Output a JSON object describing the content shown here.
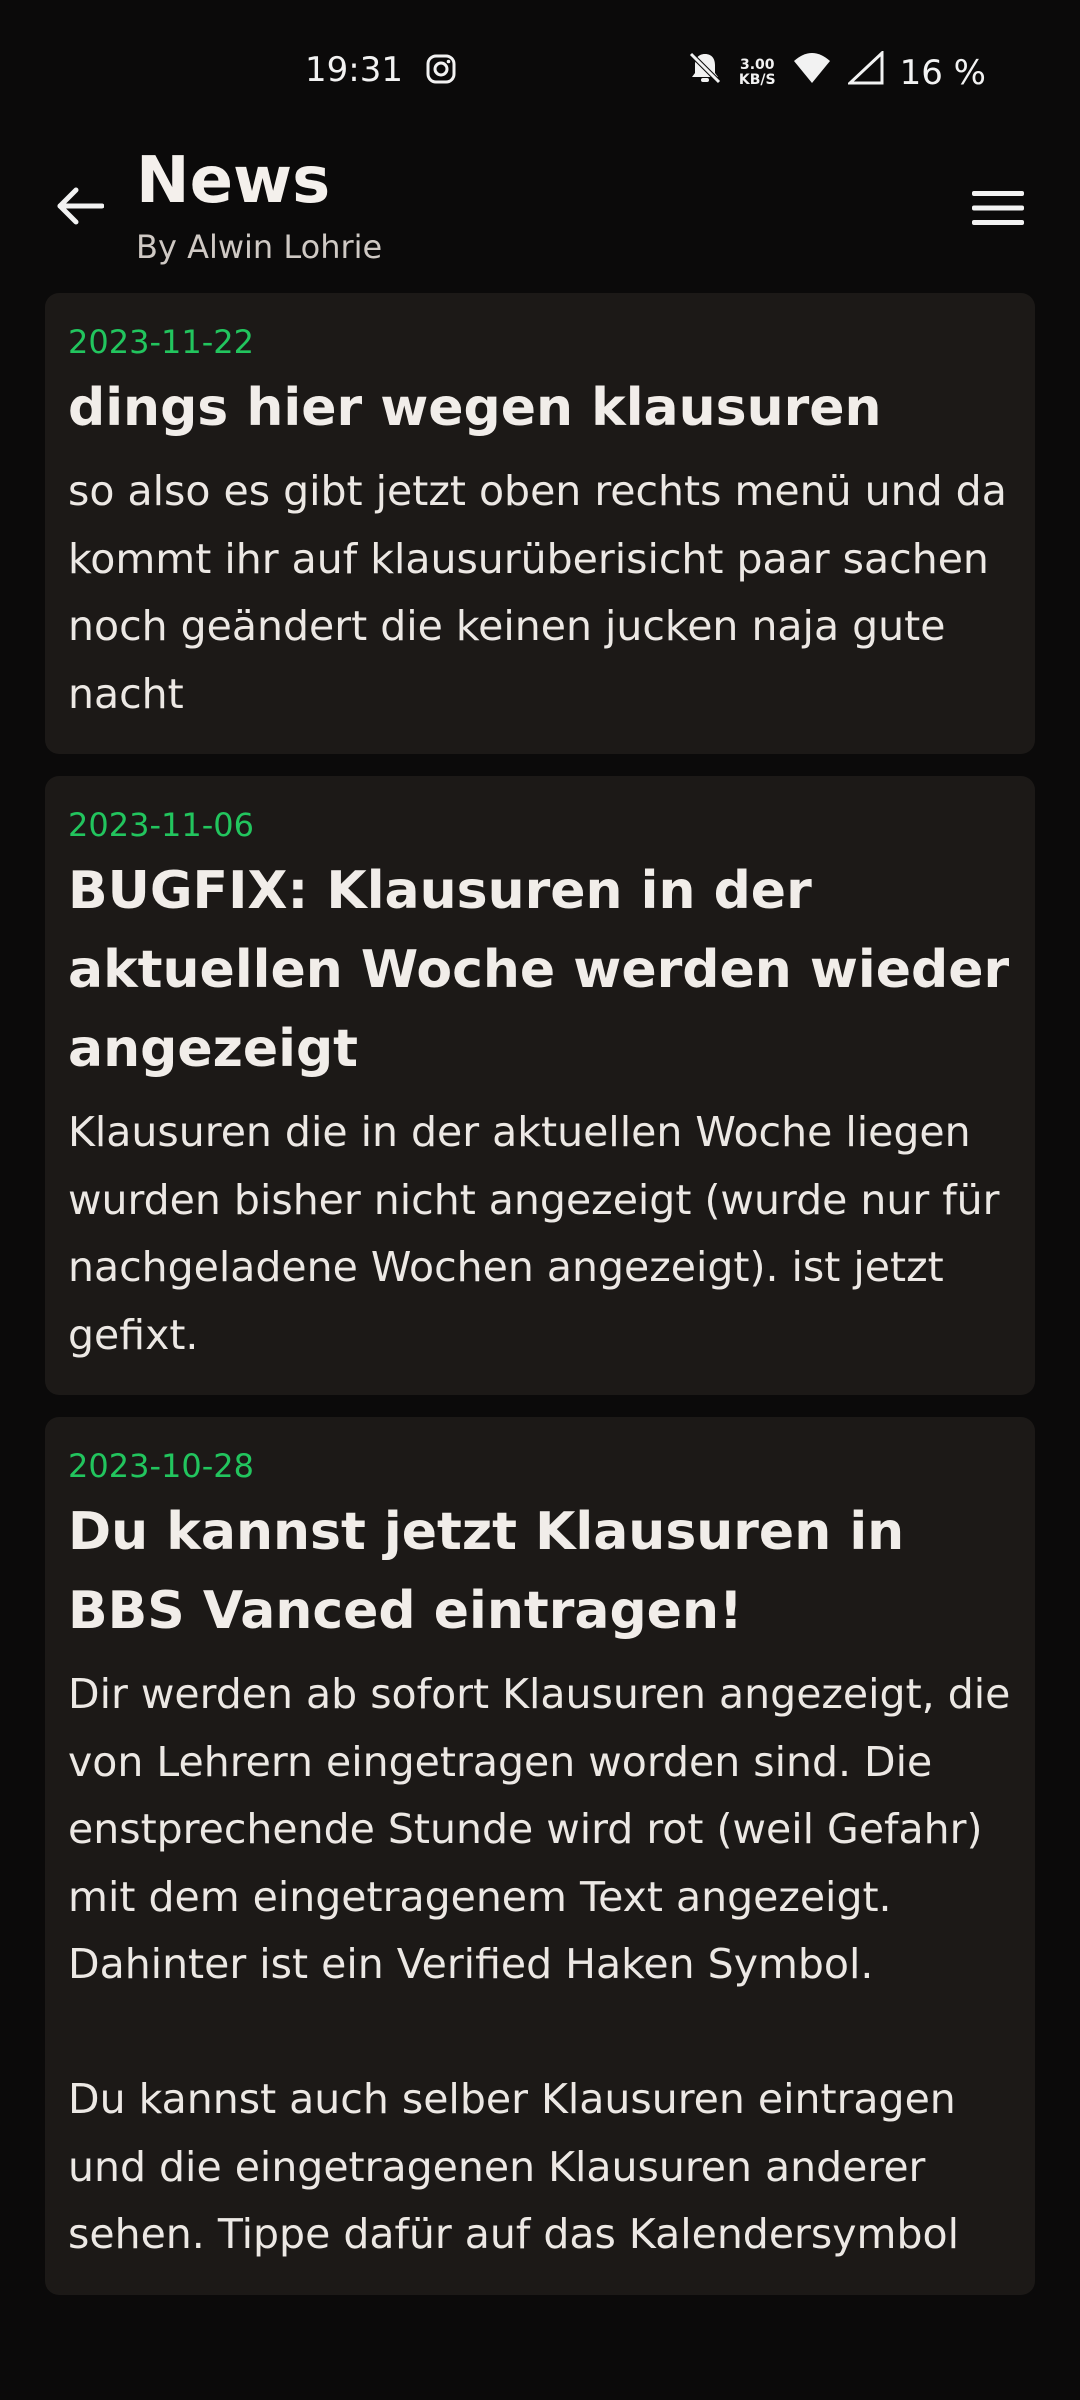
{
  "status_bar": {
    "time": "19:31",
    "speed_value": "3.00",
    "speed_unit": "KB/S",
    "battery": "16 %",
    "icons": [
      "instagram-icon",
      "bell-off-icon",
      "wifi-icon",
      "signal-icon"
    ]
  },
  "app_bar": {
    "title": "News",
    "subtitle": "By Alwin Lohrie",
    "back_icon": "arrow-left-icon",
    "menu_icon": "hamburger-menu-icon"
  },
  "colors": {
    "background": "#0b0a0a",
    "card": "#1c1917",
    "accent_date": "#22c55e",
    "text": "#ece8e4"
  },
  "news": [
    {
      "date": "2023-11-22",
      "title": "dings hier wegen klausuren",
      "body": "so also es gibt jetzt oben rechts menü und da kommt ihr auf klausurüberisicht paar sachen noch geändert die keinen jucken naja gute nacht"
    },
    {
      "date": "2023-11-06",
      "title": "BUGFIX: Klausuren in der aktuellen Woche werden wieder angezeigt",
      "body": "Klausuren die in der aktuellen Woche liegen wurden bisher nicht angezeigt (wurde nur für nachgeladene Wochen angezeigt). ist jetzt gefixt."
    },
    {
      "date": "2023-10-28",
      "title": "Du kannst jetzt Klausuren in BBS Vanced eintragen!",
      "body": "Dir werden ab sofort Klausuren angezeigt, die von Lehrern eingetragen worden sind. Die enstprechende Stunde wird rot (weil Gefahr) mit dem eingetragenem Text angezeigt. Dahinter ist ein Verified Haken Symbol.\n\nDu kannst auch selber Klausuren eintragen und die eingetragenen Klausuren anderer sehen. Tippe dafür auf das Kalendersymbol"
    }
  ]
}
